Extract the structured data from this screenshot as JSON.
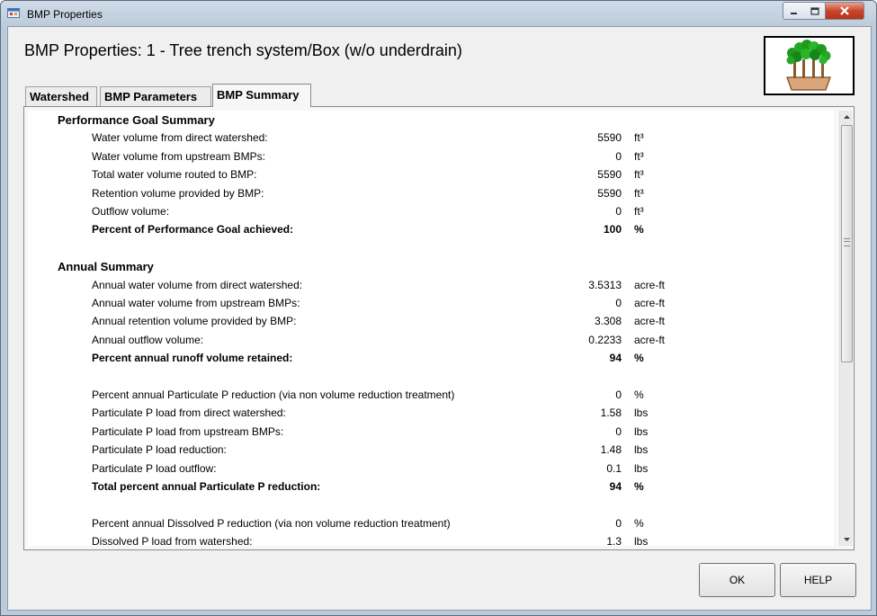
{
  "window": {
    "title": "BMP Properties"
  },
  "dialog": {
    "title": "BMP Properties: 1 - Tree trench system/Box (w/o underdrain)"
  },
  "tabs": [
    {
      "label": "Watershed"
    },
    {
      "label": "BMP Parameters"
    },
    {
      "label": "BMP Summary",
      "active": true
    }
  ],
  "summary": {
    "rows": [
      {
        "type": "header",
        "label": "Performance Goal Summary"
      },
      {
        "label": "Water volume from direct watershed:",
        "value": "5590",
        "unit": "ft³"
      },
      {
        "label": "Water volume from upstream BMPs:",
        "value": "0",
        "unit": "ft³"
      },
      {
        "label": "Total water volume routed to BMP:",
        "value": "5590",
        "unit": "ft³"
      },
      {
        "label": "Retention volume provided by BMP:",
        "value": "5590",
        "unit": "ft³"
      },
      {
        "label": "Outflow volume:",
        "value": "0",
        "unit": "ft³"
      },
      {
        "type": "bold",
        "label": "Percent of Performance Goal achieved:",
        "value": "100",
        "unit": "%"
      },
      {
        "type": "spacer"
      },
      {
        "type": "header",
        "label": "Annual Summary"
      },
      {
        "label": "Annual water volume from direct watershed:",
        "value": "3.5313",
        "unit": "acre-ft"
      },
      {
        "label": "Annual water volume from upstream BMPs:",
        "value": "0",
        "unit": "acre-ft"
      },
      {
        "label": "Annual retention volume provided by BMP:",
        "value": "3.308",
        "unit": "acre-ft"
      },
      {
        "label": "Annual outflow volume:",
        "value": "0.2233",
        "unit": "acre-ft"
      },
      {
        "type": "bold",
        "label": "Percent annual runoff volume retained:",
        "value": "94",
        "unit": "%"
      },
      {
        "type": "spacer"
      },
      {
        "label": "Percent annual Particulate P reduction (via non volume reduction treatment)",
        "value": "0",
        "unit": "%"
      },
      {
        "label": "Particulate P load from direct watershed:",
        "value": "1.58",
        "unit": "lbs"
      },
      {
        "label": "Particulate P load from upstream BMPs:",
        "value": "0",
        "unit": "lbs"
      },
      {
        "label": "Particulate P load reduction:",
        "value": "1.48",
        "unit": "lbs"
      },
      {
        "label": "Particulate P load outflow:",
        "value": "0.1",
        "unit": "lbs"
      },
      {
        "type": "bold",
        "label": "Total percent annual Particulate P reduction:",
        "value": "94",
        "unit": "%"
      },
      {
        "type": "spacer"
      },
      {
        "label": "Percent annual Dissolved P reduction (via non volume reduction treatment)",
        "value": "0",
        "unit": "%"
      },
      {
        "label": "Dissolved P load from watershed:",
        "value": "1.3",
        "unit": "lbs"
      }
    ]
  },
  "buttons": {
    "ok": "OK",
    "help": "HELP"
  },
  "icons": {
    "app": "app-window-icon",
    "bmp_image": "tree-trench-icon",
    "minimize": "minimize-icon",
    "maximize": "maximize-icon",
    "close": "close-icon"
  },
  "colors": {
    "close_button": "#c9462c",
    "tree_green": "#1e9a1e",
    "planter": "#d8a67a"
  }
}
